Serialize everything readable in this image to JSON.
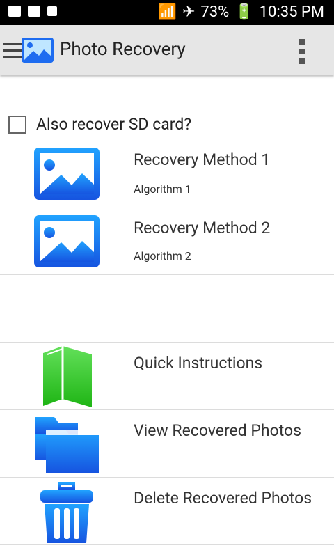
{
  "status": {
    "battery": "73%",
    "time": "10:35 PM"
  },
  "app": {
    "title": "Photo Recovery"
  },
  "options": {
    "sd_label": "Also recover SD card?"
  },
  "methods": [
    {
      "title": "Recovery Method 1",
      "subtitle": "Algorithm 1"
    },
    {
      "title": "Recovery Method 2",
      "subtitle": "Algorithm 2"
    }
  ],
  "actions": [
    {
      "title": "Quick Instructions"
    },
    {
      "title": "View Recovered Photos"
    },
    {
      "title": "Delete Recovered Photos"
    }
  ],
  "colors": {
    "accent_blue": "#1a73e8",
    "green": "#39c72d"
  }
}
